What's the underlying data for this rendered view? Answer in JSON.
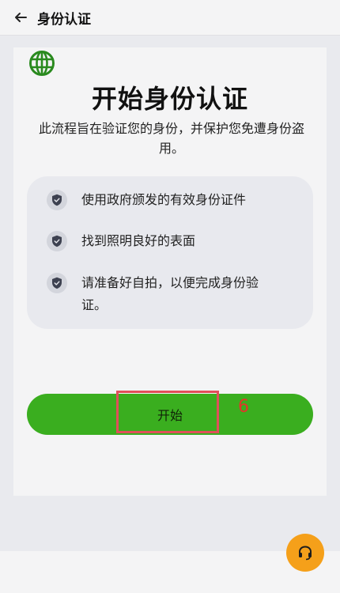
{
  "header": {
    "back_icon": "arrow-left-icon",
    "title": "身份认证"
  },
  "card": {
    "globe_icon": "globe-icon",
    "title": "开始身份认证",
    "subtitle": "此流程旨在验证您的身份，并保护您免遭身份盗用。",
    "requirements": [
      {
        "icon": "shield-check-icon",
        "text": "使用政府颁发的有效身份证件"
      },
      {
        "icon": "shield-check-icon",
        "text": "找到照明良好的表面"
      },
      {
        "icon": "shield-check-icon",
        "text": "请准备好自拍，以便完成身份验证。"
      }
    ],
    "start_label": "开始",
    "annotation_number": "6"
  },
  "support": {
    "icon": "headset-icon"
  },
  "colors": {
    "brand_green": "#3aae1f",
    "globe_green": "#2a8a1f",
    "support_orange": "#f5a01a",
    "annotation_red": "#e0505a"
  }
}
